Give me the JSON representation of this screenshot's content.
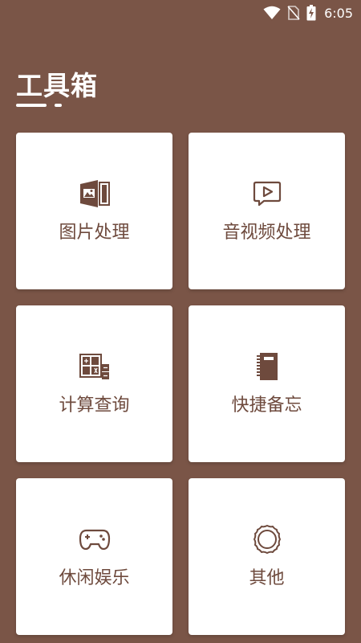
{
  "status_bar": {
    "time": "6:05",
    "icons": [
      "wifi-icon",
      "no-sim-icon",
      "battery-charging-icon"
    ]
  },
  "header": {
    "title": "工具箱"
  },
  "colors": {
    "background": "#7a5547",
    "card": "#ffffff",
    "accent": "#6e4a3d"
  },
  "tools": [
    {
      "label": "图片处理",
      "icon": "image-gallery-icon"
    },
    {
      "label": "音视频处理",
      "icon": "video-play-icon"
    },
    {
      "label": "计算查询",
      "icon": "calculator-icon"
    },
    {
      "label": "快捷备忘",
      "icon": "notebook-icon"
    },
    {
      "label": "休闲娱乐",
      "icon": "gamepad-icon"
    },
    {
      "label": "其他",
      "icon": "other-circle-icon"
    }
  ]
}
